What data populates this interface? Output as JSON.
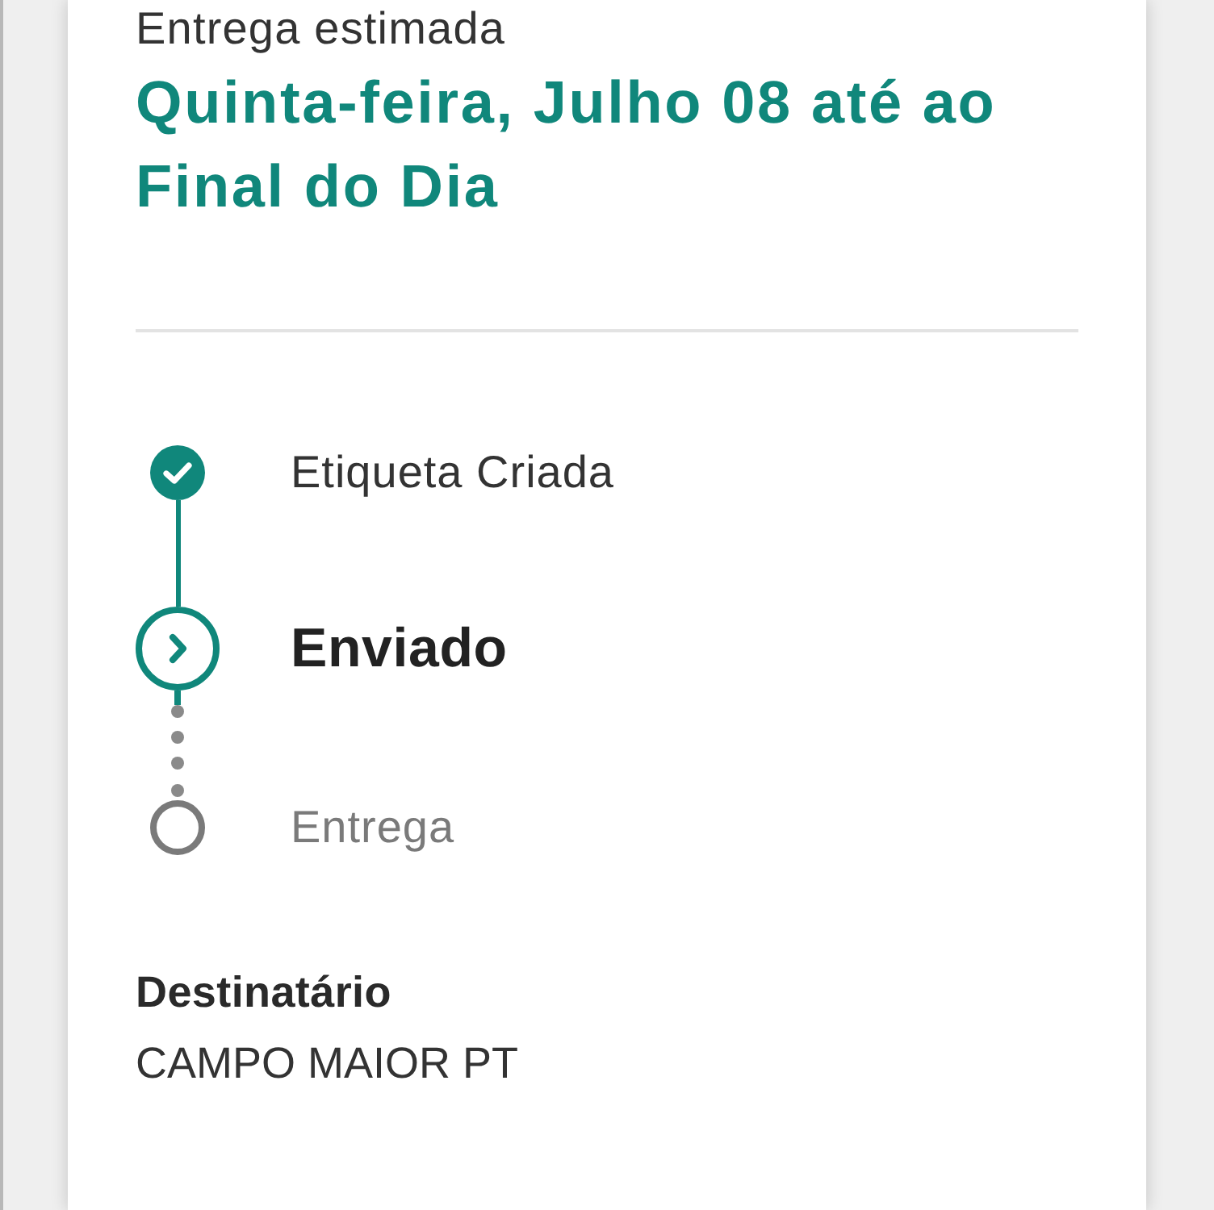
{
  "delivery": {
    "label": "Entrega estimada",
    "date": "Quinta-feira, Julho 08 até ao Final do Dia"
  },
  "timeline": [
    {
      "label": "Etiqueta Criada",
      "kind": "done"
    },
    {
      "label": "Enviado",
      "kind": "current"
    },
    {
      "label": "Entrega",
      "kind": "pending"
    }
  ],
  "recipient": {
    "label": "Destinatário",
    "value": "CAMPO MAIOR PT"
  }
}
